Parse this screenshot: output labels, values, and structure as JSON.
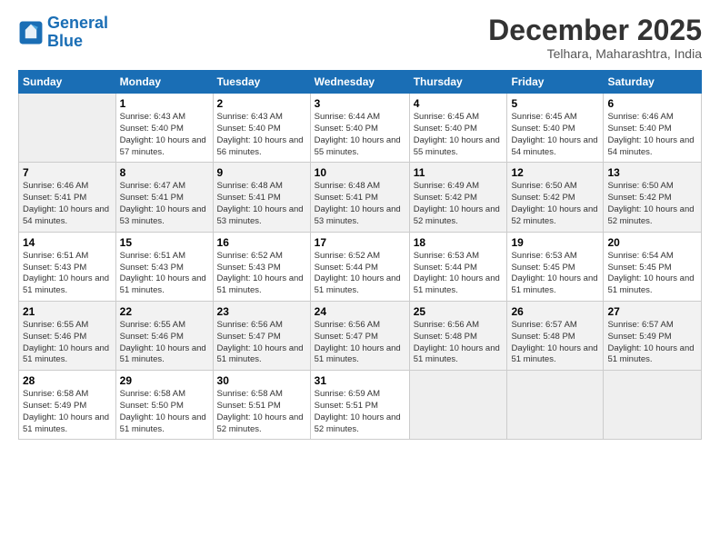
{
  "logo": {
    "line1": "General",
    "line2": "Blue"
  },
  "title": "December 2025",
  "location": "Telhara, Maharashtra, India",
  "days_of_week": [
    "Sunday",
    "Monday",
    "Tuesday",
    "Wednesday",
    "Thursday",
    "Friday",
    "Saturday"
  ],
  "weeks": [
    [
      {
        "day": "",
        "empty": true
      },
      {
        "day": "1",
        "sunrise": "6:43 AM",
        "sunset": "5:40 PM",
        "daylight": "10 hours and 57 minutes."
      },
      {
        "day": "2",
        "sunrise": "6:43 AM",
        "sunset": "5:40 PM",
        "daylight": "10 hours and 56 minutes."
      },
      {
        "day": "3",
        "sunrise": "6:44 AM",
        "sunset": "5:40 PM",
        "daylight": "10 hours and 55 minutes."
      },
      {
        "day": "4",
        "sunrise": "6:45 AM",
        "sunset": "5:40 PM",
        "daylight": "10 hours and 55 minutes."
      },
      {
        "day": "5",
        "sunrise": "6:45 AM",
        "sunset": "5:40 PM",
        "daylight": "10 hours and 54 minutes."
      },
      {
        "day": "6",
        "sunrise": "6:46 AM",
        "sunset": "5:40 PM",
        "daylight": "10 hours and 54 minutes."
      }
    ],
    [
      {
        "day": "7",
        "sunrise": "6:46 AM",
        "sunset": "5:41 PM",
        "daylight": "10 hours and 54 minutes."
      },
      {
        "day": "8",
        "sunrise": "6:47 AM",
        "sunset": "5:41 PM",
        "daylight": "10 hours and 53 minutes."
      },
      {
        "day": "9",
        "sunrise": "6:48 AM",
        "sunset": "5:41 PM",
        "daylight": "10 hours and 53 minutes."
      },
      {
        "day": "10",
        "sunrise": "6:48 AM",
        "sunset": "5:41 PM",
        "daylight": "10 hours and 53 minutes."
      },
      {
        "day": "11",
        "sunrise": "6:49 AM",
        "sunset": "5:42 PM",
        "daylight": "10 hours and 52 minutes."
      },
      {
        "day": "12",
        "sunrise": "6:50 AM",
        "sunset": "5:42 PM",
        "daylight": "10 hours and 52 minutes."
      },
      {
        "day": "13",
        "sunrise": "6:50 AM",
        "sunset": "5:42 PM",
        "daylight": "10 hours and 52 minutes."
      }
    ],
    [
      {
        "day": "14",
        "sunrise": "6:51 AM",
        "sunset": "5:43 PM",
        "daylight": "10 hours and 51 minutes."
      },
      {
        "day": "15",
        "sunrise": "6:51 AM",
        "sunset": "5:43 PM",
        "daylight": "10 hours and 51 minutes."
      },
      {
        "day": "16",
        "sunrise": "6:52 AM",
        "sunset": "5:43 PM",
        "daylight": "10 hours and 51 minutes."
      },
      {
        "day": "17",
        "sunrise": "6:52 AM",
        "sunset": "5:44 PM",
        "daylight": "10 hours and 51 minutes."
      },
      {
        "day": "18",
        "sunrise": "6:53 AM",
        "sunset": "5:44 PM",
        "daylight": "10 hours and 51 minutes."
      },
      {
        "day": "19",
        "sunrise": "6:53 AM",
        "sunset": "5:45 PM",
        "daylight": "10 hours and 51 minutes."
      },
      {
        "day": "20",
        "sunrise": "6:54 AM",
        "sunset": "5:45 PM",
        "daylight": "10 hours and 51 minutes."
      }
    ],
    [
      {
        "day": "21",
        "sunrise": "6:55 AM",
        "sunset": "5:46 PM",
        "daylight": "10 hours and 51 minutes."
      },
      {
        "day": "22",
        "sunrise": "6:55 AM",
        "sunset": "5:46 PM",
        "daylight": "10 hours and 51 minutes."
      },
      {
        "day": "23",
        "sunrise": "6:56 AM",
        "sunset": "5:47 PM",
        "daylight": "10 hours and 51 minutes."
      },
      {
        "day": "24",
        "sunrise": "6:56 AM",
        "sunset": "5:47 PM",
        "daylight": "10 hours and 51 minutes."
      },
      {
        "day": "25",
        "sunrise": "6:56 AM",
        "sunset": "5:48 PM",
        "daylight": "10 hours and 51 minutes."
      },
      {
        "day": "26",
        "sunrise": "6:57 AM",
        "sunset": "5:48 PM",
        "daylight": "10 hours and 51 minutes."
      },
      {
        "day": "27",
        "sunrise": "6:57 AM",
        "sunset": "5:49 PM",
        "daylight": "10 hours and 51 minutes."
      }
    ],
    [
      {
        "day": "28",
        "sunrise": "6:58 AM",
        "sunset": "5:49 PM",
        "daylight": "10 hours and 51 minutes."
      },
      {
        "day": "29",
        "sunrise": "6:58 AM",
        "sunset": "5:50 PM",
        "daylight": "10 hours and 51 minutes."
      },
      {
        "day": "30",
        "sunrise": "6:58 AM",
        "sunset": "5:51 PM",
        "daylight": "10 hours and 52 minutes."
      },
      {
        "day": "31",
        "sunrise": "6:59 AM",
        "sunset": "5:51 PM",
        "daylight": "10 hours and 52 minutes."
      },
      {
        "day": "",
        "empty": true
      },
      {
        "day": "",
        "empty": true
      },
      {
        "day": "",
        "empty": true
      }
    ]
  ]
}
